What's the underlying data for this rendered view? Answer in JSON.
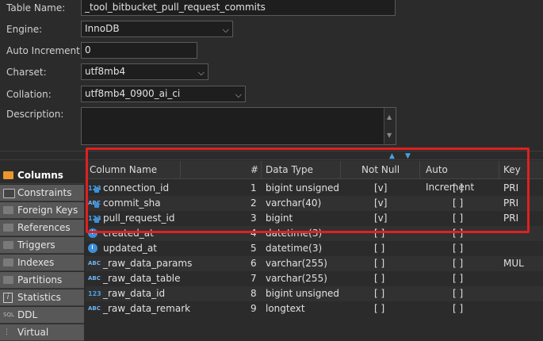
{
  "form": {
    "table_name_label": "Table Name:",
    "table_name_value": "_tool_bitbucket_pull_request_commits",
    "engine_label": "Engine:",
    "engine_value": "InnoDB",
    "auto_increment_label": "Auto Increment:",
    "auto_increment_value": "0",
    "charset_label": "Charset:",
    "charset_value": "utf8mb4",
    "collation_label": "Collation:",
    "collation_value": "utf8mb4_0900_ai_ci",
    "description_label": "Description:",
    "description_value": ""
  },
  "sidebar": {
    "items": [
      {
        "label": "Columns",
        "icon": "columns-folder-icon",
        "active": true
      },
      {
        "label": "Constraints",
        "icon": "constraints-icon"
      },
      {
        "label": "Foreign Keys",
        "icon": "folder-icon"
      },
      {
        "label": "References",
        "icon": "folder-icon"
      },
      {
        "label": "Triggers",
        "icon": "folder-icon"
      },
      {
        "label": "Indexes",
        "icon": "folder-icon"
      },
      {
        "label": "Partitions",
        "icon": "folder-icon"
      },
      {
        "label": "Statistics",
        "icon": "info-icon"
      },
      {
        "label": "DDL",
        "icon": "ddl-icon"
      },
      {
        "label": "Virtual",
        "icon": "virtual-icon"
      }
    ]
  },
  "grid": {
    "headers": [
      "Column Name",
      "#",
      "Data Type",
      "Not Null",
      "Auto Increment",
      "Key"
    ],
    "rows": [
      {
        "icon": "123",
        "name": "connection_id",
        "num": "1",
        "type": "bigint unsigned",
        "notnull": "[v]",
        "autoinc": "[ ]",
        "key": "PRI"
      },
      {
        "icon": "ABC",
        "name": "commit_sha",
        "num": "2",
        "type": "varchar(40)",
        "notnull": "[v]",
        "autoinc": "[ ]",
        "key": "PRI"
      },
      {
        "icon": "123",
        "name": "pull_request_id",
        "num": "3",
        "type": "bigint",
        "notnull": "[v]",
        "autoinc": "[ ]",
        "key": "PRI"
      },
      {
        "icon": "clock",
        "name": "created_at",
        "num": "4",
        "type": "datetime(3)",
        "notnull": "[ ]",
        "autoinc": "[ ]",
        "key": ""
      },
      {
        "icon": "clock",
        "name": "updated_at",
        "num": "5",
        "type": "datetime(3)",
        "notnull": "[ ]",
        "autoinc": "[ ]",
        "key": ""
      },
      {
        "icon": "ABC",
        "name": "_raw_data_params",
        "num": "6",
        "type": "varchar(255)",
        "notnull": "[ ]",
        "autoinc": "[ ]",
        "key": "MUL"
      },
      {
        "icon": "ABC",
        "name": "_raw_data_table",
        "num": "7",
        "type": "varchar(255)",
        "notnull": "[ ]",
        "autoinc": "[ ]",
        "key": ""
      },
      {
        "icon": "123",
        "name": "_raw_data_id",
        "num": "8",
        "type": "bigint unsigned",
        "notnull": "[ ]",
        "autoinc": "[ ]",
        "key": ""
      },
      {
        "icon": "ABC",
        "name": "_raw_data_remark",
        "num": "9",
        "type": "longtext",
        "notnull": "[ ]",
        "autoinc": "[ ]",
        "key": ""
      }
    ]
  },
  "colors": {
    "highlight": "#e02020",
    "accent": "#3d8fd8",
    "folder_active": "#e9962d"
  }
}
